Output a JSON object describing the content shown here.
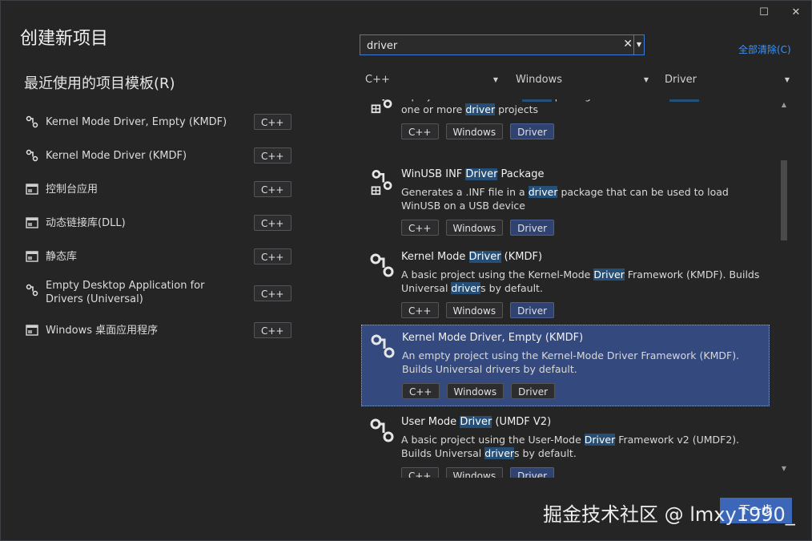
{
  "window": {
    "title": "创建新项目",
    "maximize_glyph": "☐",
    "close_glyph": "✕"
  },
  "recent": {
    "title": "最近使用的项目模板(R)",
    "items": [
      {
        "label": "Kernel Mode Driver, Empty (KMDF)",
        "tag": "C++",
        "icon": "driver-icon"
      },
      {
        "label": "Kernel Mode Driver (KMDF)",
        "tag": "C++",
        "icon": "driver-icon"
      },
      {
        "label": "控制台应用",
        "tag": "C++",
        "icon": "console-app-icon"
      },
      {
        "label": "动态链接库(DLL)",
        "tag": "C++",
        "icon": "dll-icon"
      },
      {
        "label": "静态库",
        "tag": "C++",
        "icon": "static-lib-icon"
      },
      {
        "label": "Empty Desktop Application for Drivers (Universal)",
        "tag": "C++",
        "icon": "driver-icon"
      },
      {
        "label": "Windows 桌面应用程序",
        "tag": "C++",
        "icon": "desktop-app-icon"
      }
    ]
  },
  "search": {
    "value": "driver",
    "placeholder": "",
    "clear_glyph": "✕",
    "clear_all_label": "全部清除(C)"
  },
  "filters": {
    "language": "C++",
    "platform": "Windows",
    "project_type": "Driver"
  },
  "results": [
    {
      "title_parts": [],
      "desc_parts": [
        [
          "A project that creates a ",
          false
        ],
        [
          "driver",
          true
        ],
        [
          " package that contains ",
          false
        ],
        [
          "driver",
          true
        ],
        [
          " files from one or more ",
          false
        ],
        [
          "driver",
          true
        ],
        [
          " projects",
          false
        ]
      ],
      "tags": [
        "C++",
        "Windows",
        "Driver"
      ]
    },
    {
      "title_parts": [
        [
          "WinUSB INF ",
          false
        ],
        [
          "Driver",
          true
        ],
        [
          " Package",
          false
        ]
      ],
      "desc_parts": [
        [
          "Generates a .INF file in a ",
          false
        ],
        [
          "driver",
          true
        ],
        [
          " package that can be used to load WinUSB on a USB device",
          false
        ]
      ],
      "tags": [
        "C++",
        "Windows",
        "Driver"
      ]
    },
    {
      "title_parts": [
        [
          "Kernel Mode ",
          false
        ],
        [
          "Driver",
          true
        ],
        [
          " (KMDF)",
          false
        ]
      ],
      "desc_parts": [
        [
          "A basic project using the Kernel-Mode ",
          false
        ],
        [
          "Driver",
          true
        ],
        [
          " Framework (KMDF). Builds Universal ",
          false
        ],
        [
          "driver",
          true
        ],
        [
          "s by default.",
          false
        ]
      ],
      "tags": [
        "C++",
        "Windows",
        "Driver"
      ]
    },
    {
      "title_parts": [
        [
          "Kernel Mode Driver, Empty (KMDF)",
          false
        ]
      ],
      "desc_parts": [
        [
          "An empty project using the Kernel-Mode Driver Framework (KMDF). Builds Universal drivers by default.",
          false
        ]
      ],
      "tags": [
        "C++",
        "Windows",
        "Driver"
      ],
      "selected": true
    },
    {
      "title_parts": [
        [
          "User Mode ",
          false
        ],
        [
          "Driver",
          true
        ],
        [
          " (UMDF V2)",
          false
        ]
      ],
      "desc_parts": [
        [
          "A basic project using the User-Mode ",
          false
        ],
        [
          "Driver",
          true
        ],
        [
          " Framework v2 (UMDF2). Builds Universal ",
          false
        ],
        [
          "driver",
          true
        ],
        [
          "s by default.",
          false
        ]
      ],
      "tags": [
        "C++",
        "Windows",
        "Driver"
      ]
    }
  ],
  "scroll": {
    "position": 0.2
  },
  "next_button_label": "下一步",
  "watermark": "掘金技术社区 @ lmxy1990_",
  "colors": {
    "background": "#252526",
    "accent": "#3c67b8",
    "selected_card": "#34497d",
    "highlight": "#264f78",
    "link": "#3794ff"
  }
}
